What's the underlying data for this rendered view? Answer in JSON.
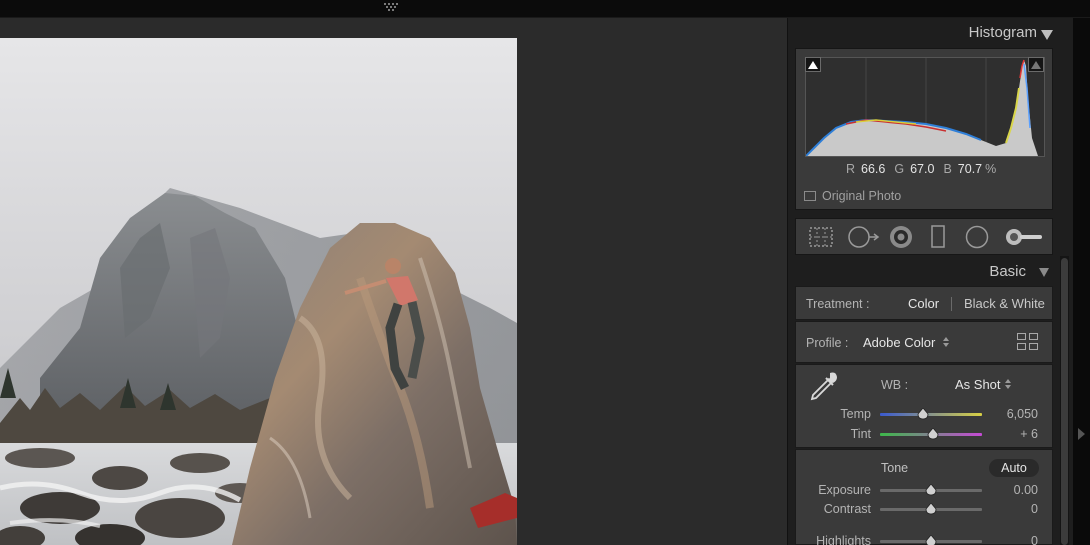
{
  "histogram": {
    "title": "Histogram",
    "rgb": {
      "r_label": "R",
      "r_value": "66.6",
      "g_label": "G",
      "g_value": "67.0",
      "b_label": "B",
      "b_value": "70.7",
      "unit": "%"
    },
    "original_photo_label": "Original Photo"
  },
  "tools": [
    "crop-overlay-icon",
    "spot-removal-icon",
    "red-eye-icon",
    "graduated-filter-icon",
    "radial-filter-icon",
    "adjustment-brush-icon"
  ],
  "basic": {
    "title": "Basic",
    "treatment_label": "Treatment :",
    "treatment_color": "Color",
    "treatment_bw": "Black & White",
    "profile_label": "Profile :",
    "profile_value": "Adobe Color",
    "wb_label": "WB :",
    "wb_value": "As Shot",
    "temp_label": "Temp",
    "temp_value": "6,050",
    "temp_level": 0.42,
    "tint_label": "Tint",
    "tint_value": "+ 6",
    "tint_level": 0.52,
    "tone_label": "Tone",
    "auto_label": "Auto",
    "exposure_label": "Exposure",
    "exposure_value": "0.00",
    "exposure_level": 0.5,
    "contrast_label": "Contrast",
    "contrast_value": "0",
    "contrast_level": 0.5,
    "highlights_label": "Highlights",
    "highlights_value": "0",
    "highlights_level": 0.5
  },
  "colors": {
    "panel_bg": "#3a3a3a",
    "canvas_bg": "#2b2b2b",
    "accent_text": "#e6e6e6"
  }
}
